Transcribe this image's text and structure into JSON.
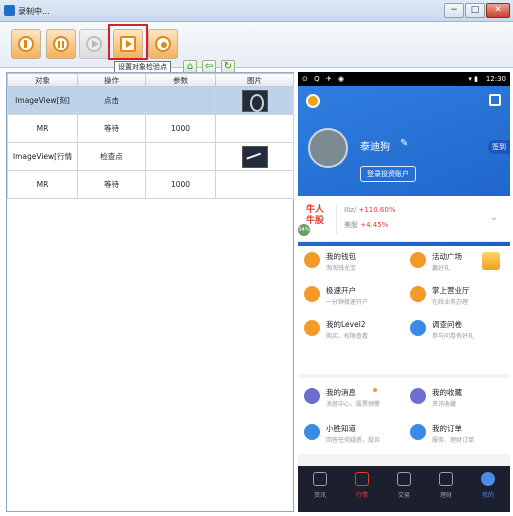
{
  "window": {
    "title": "录制中...",
    "minimize": "−",
    "maximize": "□",
    "close": "✕"
  },
  "toolbar": {
    "buttons": [
      {
        "name": "power",
        "icon": "power-icon"
      },
      {
        "name": "pause",
        "icon": "pause-icon"
      },
      {
        "name": "play",
        "icon": "play-icon",
        "disabled": true
      },
      {
        "name": "checkpoint",
        "icon": "checkpoint-icon"
      },
      {
        "name": "lamp",
        "icon": "lamp-icon"
      }
    ],
    "small": {
      "home": "⌂",
      "back": "⇦",
      "refresh": "↻"
    },
    "tooltip": "设置对象检验点"
  },
  "table": {
    "headers": [
      "对象",
      "操作",
      "参数",
      "图片"
    ],
    "rows": [
      {
        "object": "ImageView[刻]",
        "action": "点击",
        "param": "",
        "image": "avatar"
      },
      {
        "object": "MR",
        "action": "等待",
        "param": "1000",
        "image": ""
      },
      {
        "object": "ImageView[行情",
        "action": "检查点",
        "param": "",
        "image": "trend"
      },
      {
        "object": "MR",
        "action": "等待",
        "param": "1000",
        "image": ""
      }
    ],
    "selected_row": 0
  },
  "phone": {
    "status_icons": "⊙ Q ✈ ◉",
    "signal": "▾ ▮",
    "time": "12:30",
    "user_name": "泰迪狗",
    "edit_glyph": "✎",
    "signin": "签到",
    "login_button": "登录投资账户",
    "market": {
      "logo": "牛人 牛股",
      "row1_label": "IIIz/",
      "row1_value": "+110.60%",
      "row2_label": "美股",
      "row2_value": "+4.45%",
      "badge": "34%",
      "chevron": "⌄"
    },
    "menu": [
      {
        "title": "我的钱包",
        "sub": "淘淘钱允宝",
        "color": "orange"
      },
      {
        "title": "活动广场",
        "sub": "赢好礼",
        "color": "orange"
      },
      {
        "title": "极速开户",
        "sub": "一分钟极速开户",
        "color": "orange"
      },
      {
        "title": "掌上营业厅",
        "sub": "在线业务办理",
        "color": "orange"
      },
      {
        "title": "我的Level2",
        "sub": "购买、权限查看",
        "color": "orange"
      },
      {
        "title": "调查问卷",
        "sub": "参与问卷有好礼",
        "color": "blue"
      }
    ],
    "menu2": [
      {
        "title": "我的消息",
        "sub": "消息中心、股票预警",
        "color": "purple"
      },
      {
        "title": "我的收藏",
        "sub": "资讯收藏",
        "color": "purple"
      },
      {
        "title": "小胜知道",
        "sub": "回答任何疑惑，投诉",
        "color": "blue"
      },
      {
        "title": "我的订单",
        "sub": "服务、理财订单",
        "color": "blue"
      }
    ],
    "nav": [
      "资讯",
      "行情",
      "交易",
      "理财",
      "我的"
    ]
  }
}
